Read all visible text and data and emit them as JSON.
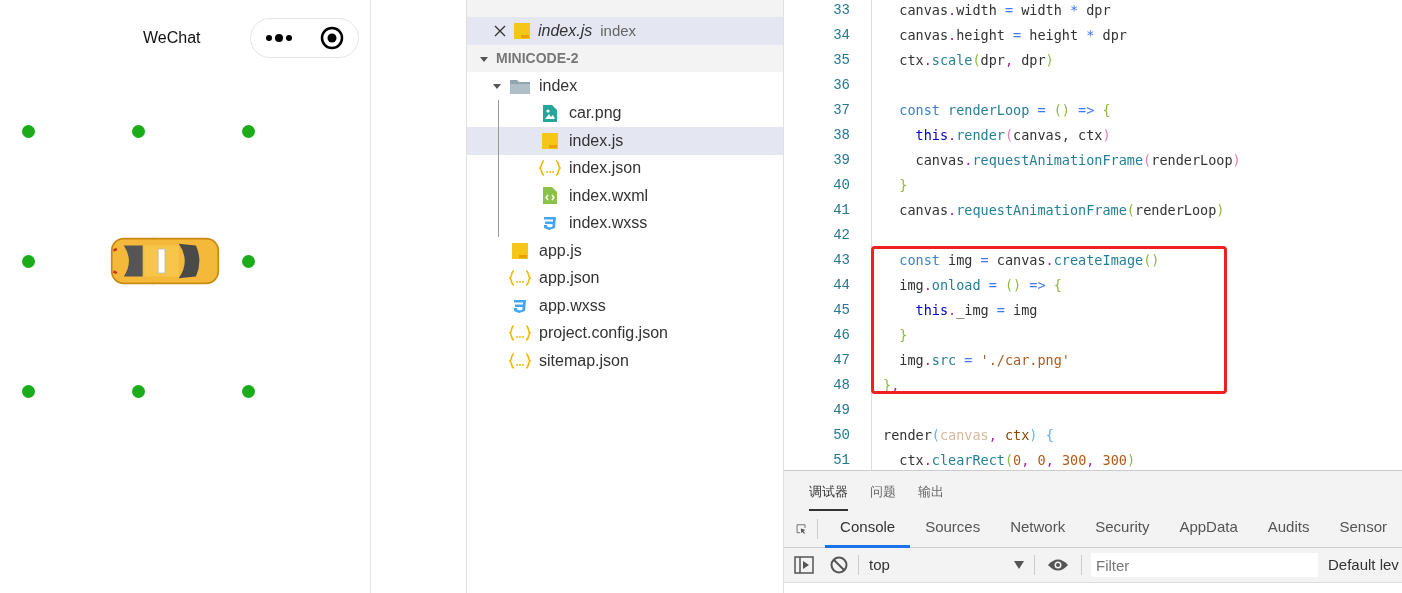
{
  "phone": {
    "title": "WeChat"
  },
  "explorer": {
    "open_editors": [
      {
        "file": "index.js",
        "path": "index",
        "kind": "js",
        "selected": true
      }
    ],
    "project": {
      "name": "MINICODE-2",
      "expanded": true,
      "tree": [
        {
          "label": "index",
          "kind": "folder",
          "expanded": true,
          "selected": false,
          "children": [
            {
              "label": "car.png",
              "kind": "image",
              "selected": false
            },
            {
              "label": "index.js",
              "kind": "js",
              "selected": true
            },
            {
              "label": "index.json",
              "kind": "json",
              "selected": false
            },
            {
              "label": "index.wxml",
              "kind": "wxml",
              "selected": false
            },
            {
              "label": "index.wxss",
              "kind": "css",
              "selected": false
            }
          ]
        },
        {
          "label": "app.js",
          "kind": "js",
          "selected": false
        },
        {
          "label": "app.json",
          "kind": "json",
          "selected": false
        },
        {
          "label": "app.wxss",
          "kind": "css",
          "selected": false
        },
        {
          "label": "project.config.json",
          "kind": "json",
          "selected": false
        },
        {
          "label": "sitemap.json",
          "kind": "json",
          "selected": false
        }
      ]
    }
  },
  "editor": {
    "lines": [
      {
        "n": "33",
        "tokens": [
          {
            "text": "  canvas",
            "kind": "id"
          },
          {
            "text": ".",
            "kind": "dot"
          },
          {
            "text": "width",
            "kind": "id"
          },
          {
            "text": " = ",
            "kind": "op"
          },
          {
            "text": "width",
            "kind": "id"
          },
          {
            "text": " * ",
            "kind": "op"
          },
          {
            "text": "dpr",
            "kind": "id"
          }
        ]
      },
      {
        "n": "34",
        "tokens": [
          {
            "text": "  canvas",
            "kind": "id"
          },
          {
            "text": ".",
            "kind": "dot"
          },
          {
            "text": "height",
            "kind": "id"
          },
          {
            "text": " = ",
            "kind": "op"
          },
          {
            "text": "height",
            "kind": "id"
          },
          {
            "text": " * ",
            "kind": "op"
          },
          {
            "text": "dpr",
            "kind": "id"
          }
        ]
      },
      {
        "n": "35",
        "tokens": [
          {
            "text": "  ctx",
            "kind": "id"
          },
          {
            "text": ".",
            "kind": "dot"
          },
          {
            "text": "scale",
            "kind": "fn"
          },
          {
            "text": "(",
            "kind": "p1"
          },
          {
            "text": "dpr",
            "kind": "id"
          },
          {
            "text": ", ",
            "kind": "dot"
          },
          {
            "text": "dpr",
            "kind": "id"
          },
          {
            "text": ")",
            "kind": "p1"
          }
        ]
      },
      {
        "n": "36"
      },
      {
        "n": "37",
        "tokens": [
          {
            "text": "  const",
            "kind": "kw"
          },
          {
            "text": " renderLoop",
            "kind": "fn"
          },
          {
            "text": " = ",
            "kind": "op"
          },
          {
            "text": "()",
            "kind": "p1"
          },
          {
            "text": " => ",
            "kind": "op"
          },
          {
            "text": "{",
            "kind": "p1"
          }
        ]
      },
      {
        "n": "38",
        "tokens": [
          {
            "text": "    this",
            "kind": "this"
          },
          {
            "text": ".",
            "kind": "dot"
          },
          {
            "text": "render",
            "kind": "fn"
          },
          {
            "text": "(",
            "kind": "p2"
          },
          {
            "text": "canvas, ctx",
            "kind": "id"
          },
          {
            "text": ")",
            "kind": "p2"
          }
        ]
      },
      {
        "n": "39",
        "tokens": [
          {
            "text": "    canvas",
            "kind": "id"
          },
          {
            "text": ".",
            "kind": "dot"
          },
          {
            "text": "requestAnimationFrame",
            "kind": "fn"
          },
          {
            "text": "(",
            "kind": "p2"
          },
          {
            "text": "renderLoop",
            "kind": "id"
          },
          {
            "text": ")",
            "kind": "p2"
          }
        ]
      },
      {
        "n": "40",
        "tokens": [
          {
            "text": "  }",
            "kind": "p1"
          }
        ]
      },
      {
        "n": "41",
        "tokens": [
          {
            "text": "  canvas",
            "kind": "id"
          },
          {
            "text": ".",
            "kind": "dot"
          },
          {
            "text": "requestAnimationFrame",
            "kind": "fn"
          },
          {
            "text": "(",
            "kind": "p1"
          },
          {
            "text": "renderLoop",
            "kind": "id"
          },
          {
            "text": ")",
            "kind": "p1"
          }
        ]
      },
      {
        "n": "42"
      },
      {
        "n": "43",
        "tokens": [
          {
            "text": "  const",
            "kind": "kw"
          },
          {
            "text": " img",
            "kind": "id"
          },
          {
            "text": " = ",
            "kind": "op"
          },
          {
            "text": "canvas",
            "kind": "id"
          },
          {
            "text": ".",
            "kind": "dot"
          },
          {
            "text": "createImage",
            "kind": "fn"
          },
          {
            "text": "()",
            "kind": "p1"
          }
        ]
      },
      {
        "n": "44",
        "tokens": [
          {
            "text": "  img",
            "kind": "id"
          },
          {
            "text": ".",
            "kind": "dot"
          },
          {
            "text": "onload",
            "kind": "fn"
          },
          {
            "text": " = ",
            "kind": "op"
          },
          {
            "text": "()",
            "kind": "p1"
          },
          {
            "text": " => ",
            "kind": "op"
          },
          {
            "text": "{",
            "kind": "p1"
          }
        ]
      },
      {
        "n": "45",
        "tokens": [
          {
            "text": "    this",
            "kind": "this"
          },
          {
            "text": ".",
            "kind": "dot"
          },
          {
            "text": "_img",
            "kind": "id"
          },
          {
            "text": " = ",
            "kind": "op"
          },
          {
            "text": "img",
            "kind": "id"
          }
        ]
      },
      {
        "n": "46",
        "tokens": [
          {
            "text": "  }",
            "kind": "p1"
          }
        ]
      },
      {
        "n": "47",
        "tokens": [
          {
            "text": "  img",
            "kind": "id"
          },
          {
            "text": ".",
            "kind": "dot"
          },
          {
            "text": "src",
            "kind": "fn"
          },
          {
            "text": " = ",
            "kind": "op"
          },
          {
            "text": "'./car.png'",
            "kind": "str"
          }
        ]
      },
      {
        "n": "48",
        "tokens": [
          {
            "text": "}",
            "kind": "p1"
          },
          {
            "text": ",",
            "kind": "dot"
          }
        ]
      },
      {
        "n": "49"
      },
      {
        "n": "50",
        "tokens": [
          {
            "text": "render",
            "kind": "id"
          },
          {
            "text": "(",
            "kind": "p3"
          },
          {
            "text": "canvas",
            "kind": "param"
          },
          {
            "text": ", ",
            "kind": "dot"
          },
          {
            "text": "ctx",
            "kind": "param2"
          },
          {
            "text": ")",
            "kind": "p3"
          },
          {
            "text": " {",
            "kind": "p3"
          }
        ]
      },
      {
        "n": "51",
        "tokens": [
          {
            "text": "  ctx",
            "kind": "id"
          },
          {
            "text": ".",
            "kind": "dot"
          },
          {
            "text": "clearRect",
            "kind": "fn"
          },
          {
            "text": "(",
            "kind": "p1"
          },
          {
            "text": "0",
            "kind": "num"
          },
          {
            "text": ", ",
            "kind": "dot"
          },
          {
            "text": "0",
            "kind": "num"
          },
          {
            "text": ", ",
            "kind": "dot"
          },
          {
            "text": "300",
            "kind": "num"
          },
          {
            "text": ", ",
            "kind": "dot"
          },
          {
            "text": "300",
            "kind": "num"
          },
          {
            "text": ")",
            "kind": "p1"
          }
        ]
      }
    ]
  },
  "devtools": {
    "panel_tabs": [
      {
        "label": "调试器",
        "selected": true
      },
      {
        "label": "问题",
        "selected": false
      },
      {
        "label": "输出",
        "selected": false
      }
    ],
    "tabs": [
      {
        "label": "Console",
        "selected": true
      },
      {
        "label": "Sources",
        "selected": false
      },
      {
        "label": "Network",
        "selected": false
      },
      {
        "label": "Security",
        "selected": false
      },
      {
        "label": "AppData",
        "selected": false
      },
      {
        "label": "Audits",
        "selected": false
      },
      {
        "label": "Sensor",
        "selected": false
      }
    ],
    "context": "top",
    "filter": {
      "placeholder": "Filter"
    },
    "levels": "Default lev"
  }
}
